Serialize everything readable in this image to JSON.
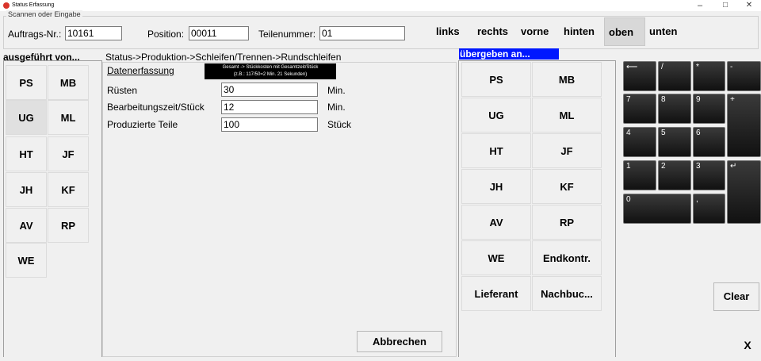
{
  "window": {
    "title": "Status Erfassung",
    "minimize": "–",
    "maximize": "□",
    "close": "✕"
  },
  "scan_group": {
    "legend": "Scannen oder Eingabe",
    "auftrag_label": "Auftrags-Nr.:",
    "auftrag_value": "10161",
    "position_label": "Position:",
    "position_value": "00011",
    "teil_label": "Teilenummer:",
    "teil_value": "01"
  },
  "directions": {
    "items": [
      "links",
      "rechts",
      "vorne",
      "hinten",
      "oben",
      "unten"
    ],
    "active": "oben"
  },
  "left_panel": {
    "header": "ausgeführt von...",
    "tiles": [
      "PS",
      "MB",
      "UG",
      "ML",
      "HT",
      "JF",
      "JH",
      "KF",
      "AV",
      "RP",
      "WE"
    ],
    "selected": "UG"
  },
  "middle": {
    "breadcrumb": "Status->Produktion->Schleifen/Trennen->Rundschleifen",
    "section_title": "Datenerfassung",
    "tooltip_line1": "Gesamt -> Stückkosten mit Gesamtzeit/Stück",
    "tooltip_line2": "(z.B.: 117/50=2 Min. 21 Sekunden)",
    "ruesten_label": "Rüsten",
    "ruesten_value": "30",
    "ruesten_unit": "Min.",
    "bearb_label": "Bearbeitungszeit/Stück",
    "bearb_value": "12",
    "bearb_unit": "Min.",
    "prod_label": "Produzierte Teile",
    "prod_value": "100",
    "prod_unit": "Stück",
    "cancel_button": "Abbrechen"
  },
  "right_panel": {
    "header": "übergeben an...",
    "tiles": [
      "PS",
      "MB",
      "UG",
      "ML",
      "HT",
      "JF",
      "JH",
      "KF",
      "AV",
      "RP",
      "WE",
      "Endkontr.",
      "Lieferant",
      "Nachbuc..."
    ]
  },
  "keypad": {
    "keys": [
      "⟵",
      "/",
      "*",
      "-",
      "7",
      "8",
      "9",
      "+",
      "4",
      "5",
      "6",
      "1",
      "2",
      "3",
      "↵",
      "0",
      ","
    ],
    "clear": "Clear",
    "x": "X"
  }
}
